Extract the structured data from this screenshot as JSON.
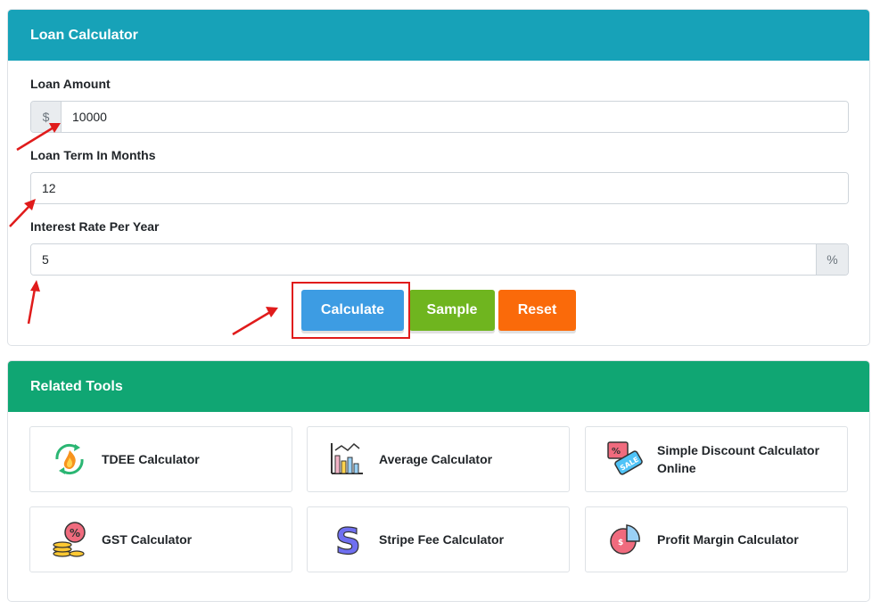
{
  "loan_calculator": {
    "title": "Loan Calculator",
    "loan_amount": {
      "label": "Loan Amount",
      "prefix": "$",
      "value": "10000"
    },
    "loan_term": {
      "label": "Loan Term In Months",
      "value": "12"
    },
    "interest_rate": {
      "label": "Interest Rate Per Year",
      "value": "5",
      "suffix": "%"
    },
    "buttons": {
      "calculate": "Calculate",
      "sample": "Sample",
      "reset": "Reset"
    }
  },
  "related_tools": {
    "title": "Related Tools",
    "items": [
      {
        "label": "TDEE Calculator",
        "icon": "tdee-icon"
      },
      {
        "label": "Average Calculator",
        "icon": "bar-chart-icon"
      },
      {
        "label": "Simple Discount Calculator Online",
        "icon": "sale-tag-icon"
      },
      {
        "label": "GST Calculator",
        "icon": "percent-coins-icon"
      },
      {
        "label": "Stripe Fee Calculator",
        "icon": "stripe-s-icon"
      },
      {
        "label": "Profit Margin Calculator",
        "icon": "pie-chart-icon"
      }
    ]
  },
  "colors": {
    "loan_header": "#17a2b8",
    "tools_header": "#10a673",
    "calculate": "#3d9ce3",
    "sample": "#6fb51f",
    "reset": "#fa6a0a",
    "annotation": "#e01b1b"
  }
}
